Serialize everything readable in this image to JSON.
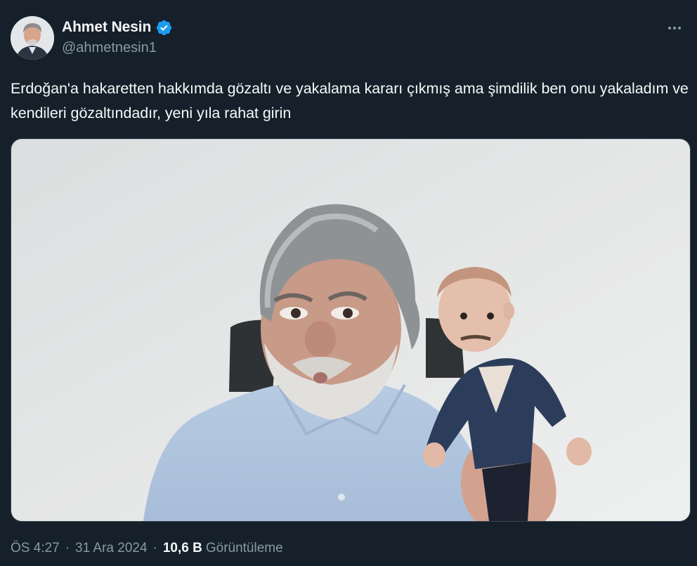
{
  "author": {
    "display_name": "Ahmet Nesin",
    "handle": "@ahmetnesin1",
    "verified": true
  },
  "tweet": {
    "text": "Erdoğan'a hakaretten hakkımda gözaltı ve yakalama kararı çıkmış ama şimdilik ben onu yakaladım ve kendileri gözaltındadır, yeni yıla rahat girin"
  },
  "meta": {
    "time": "ÖS 4:27",
    "separator": "·",
    "date": "31 Ara 2024",
    "views_count": "10,6 B",
    "views_label": "Görüntüleme"
  },
  "icons": {
    "more": "more-horizontal-icon",
    "verified": "verified-badge-icon"
  },
  "colors": {
    "background": "#15202b",
    "text_primary": "#f7f9f9",
    "text_secondary": "#8b98a5",
    "verified_blue": "#1d9bf0",
    "border": "#38444d"
  }
}
